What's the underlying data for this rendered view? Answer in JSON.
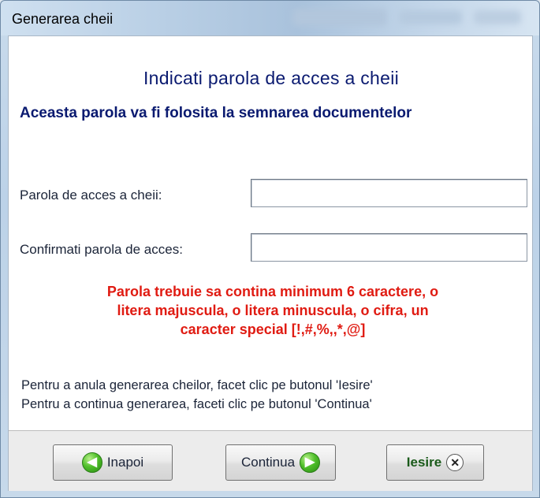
{
  "window": {
    "title": "Generarea cheii"
  },
  "header": {
    "heading": "Indicati parola de acces a cheii",
    "subheading": "Aceasta parola va fi folosita la semnarea documentelor"
  },
  "form": {
    "password_label": "Parola de acces a cheii:",
    "password_value": "",
    "confirm_label": "Confirmati parola de acces:",
    "confirm_value": ""
  },
  "warning": {
    "line1": "Parola trebuie sa contina minimum 6 caractere, o",
    "line2": "litera majuscula, o litera minuscula, o cifra, un",
    "line3": "caracter special [!,#,%,,*,@]",
    "color": "#e01b12"
  },
  "info": {
    "line1": "Pentru a anula generarea cheilor, facet clic pe butonul 'Iesire'",
    "line2": "Pentru a continua generarea, faceti clic pe butonul 'Continua'"
  },
  "buttons": {
    "back_label": "Inapoi",
    "back_icon": "arrow-left-green",
    "continue_label": "Continua",
    "continue_icon": "arrow-right-green",
    "exit_label": "Iesire",
    "exit_icon": "close-circle"
  }
}
